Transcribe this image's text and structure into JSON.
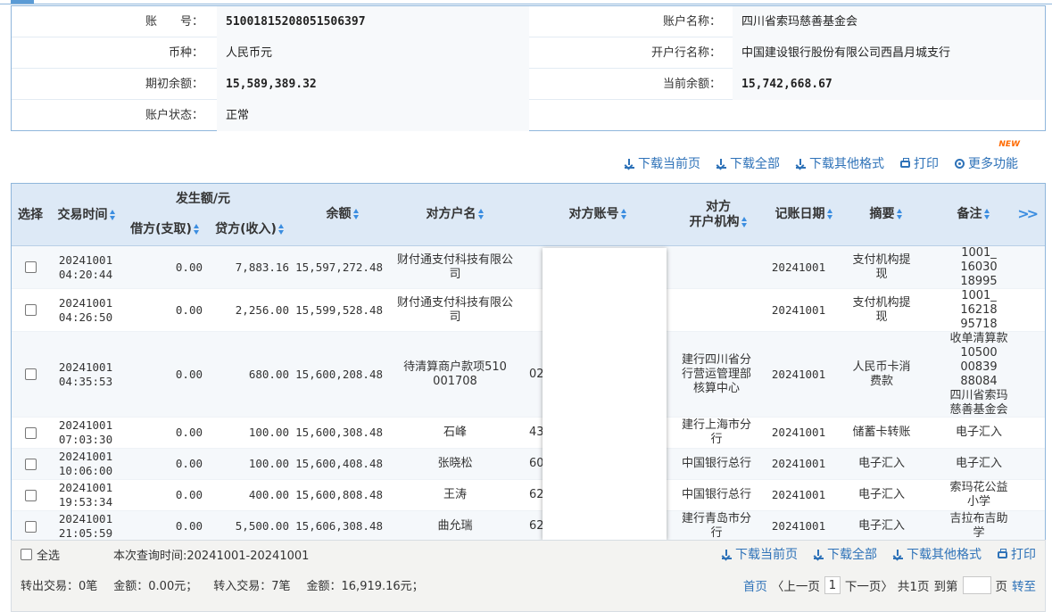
{
  "account": {
    "rows": [
      [
        {
          "label": "账　　号：",
          "value": "51001815208051506397",
          "mono": true
        },
        {
          "label": "账户名称：",
          "value": "四川省索玛慈善基金会",
          "mono": false
        }
      ],
      [
        {
          "label": "币种：",
          "value": "人民币元",
          "mono": false
        },
        {
          "label": "开户行名称：",
          "value": "中国建设银行股份有限公司西昌月城支行",
          "mono": false
        }
      ],
      [
        {
          "label": "期初余额：",
          "value": "15,589,389.32",
          "mono": true
        },
        {
          "label": "当前余额：",
          "value": "15,742,668.67",
          "mono": true
        }
      ],
      [
        {
          "label": "账户状态：",
          "value": "正常",
          "mono": false
        }
      ]
    ]
  },
  "toolbar": {
    "download_current": "下载当前页",
    "download_all": "下载全部",
    "download_other": "下载其他格式",
    "print": "打印",
    "more": "更多功能",
    "new_badge": "NEW"
  },
  "table": {
    "headers": {
      "select": "选择",
      "time": "交易时间",
      "amount_group": "发生额/元",
      "debit": "借方(支取)",
      "credit": "贷方(收入)",
      "balance": "余额",
      "counterparty_name": "对方户名",
      "counterparty_account": "对方账号",
      "counterparty_org_line1": "对方",
      "counterparty_org_line2": "开户机构",
      "post_date": "记账日期",
      "summary": "摘要",
      "memo": "备注",
      "more_columns": ">>"
    },
    "rows": [
      {
        "time": "20241001\n04:20:44",
        "debit": "0.00",
        "credit": "7,883.16",
        "balance": "15,597,272.48",
        "name": "财付通支付科技有限公\n司",
        "account": "",
        "org": "",
        "date": "20241001",
        "summary": "支付机构提\n现",
        "memo": "1001_\n16030\n18995"
      },
      {
        "time": "20241001\n04:26:50",
        "debit": "0.00",
        "credit": "2,256.00",
        "balance": "15,599,528.48",
        "name": "财付通支付科技有限公\n司",
        "account": "",
        "org": "",
        "date": "20241001",
        "summary": "支付机构提\n现",
        "memo": "1001_\n16218\n95718"
      },
      {
        "time": "20241001\n04:35:53",
        "debit": "0.00",
        "credit": "680.00",
        "balance": "15,600,208.48",
        "name": "待清算商户款项510\n001708",
        "account": "02",
        "org": "建行四川省分\n行营运管理部\n核算中心",
        "date": "20241001",
        "summary": "人民币卡消\n费款",
        "memo": "收单清算款\n10500\n00839\n88084\n四川省索玛\n慈善基金会"
      },
      {
        "time": "20241001\n07:03:30",
        "debit": "0.00",
        "credit": "100.00",
        "balance": "15,600,308.48",
        "name": "石峰",
        "account": "43",
        "org": "建行上海市分\n行",
        "date": "20241001",
        "summary": "储蓄卡转账",
        "memo": "电子汇入"
      },
      {
        "time": "20241001\n10:06:00",
        "debit": "0.00",
        "credit": "100.00",
        "balance": "15,600,408.48",
        "name": "张晓松",
        "account": "60",
        "org": "中国银行总行",
        "date": "20241001",
        "summary": "电子汇入",
        "memo": "电子汇入"
      },
      {
        "time": "20241001\n19:53:34",
        "debit": "0.00",
        "credit": "400.00",
        "balance": "15,600,808.48",
        "name": "王涛",
        "account": "62",
        "org": "中国银行总行",
        "date": "20241001",
        "summary": "电子汇入",
        "memo": "索玛花公益\n小学"
      },
      {
        "time": "20241001\n21:05:59",
        "debit": "0.00",
        "credit": "5,500.00",
        "balance": "15,606,308.48",
        "name": "曲允瑞",
        "account": "62",
        "org": "建行青岛市分\n行",
        "date": "20241001",
        "summary": "电子汇入",
        "memo": "吉拉布吉助\n学"
      }
    ]
  },
  "footer": {
    "select_all": "全选",
    "query_time": "本次查询时间:20241001-20241001",
    "stats": [
      "转出交易：0笔",
      "金额：0.00元；",
      "转入交易：7笔",
      "金额：16,919.16元；"
    ],
    "pager": {
      "first": "首页",
      "prev": "〈上一页",
      "current": "1",
      "next": "下一页〉",
      "total": "共1页",
      "goto": "到第",
      "page_unit": "页",
      "go": "转至"
    }
  }
}
